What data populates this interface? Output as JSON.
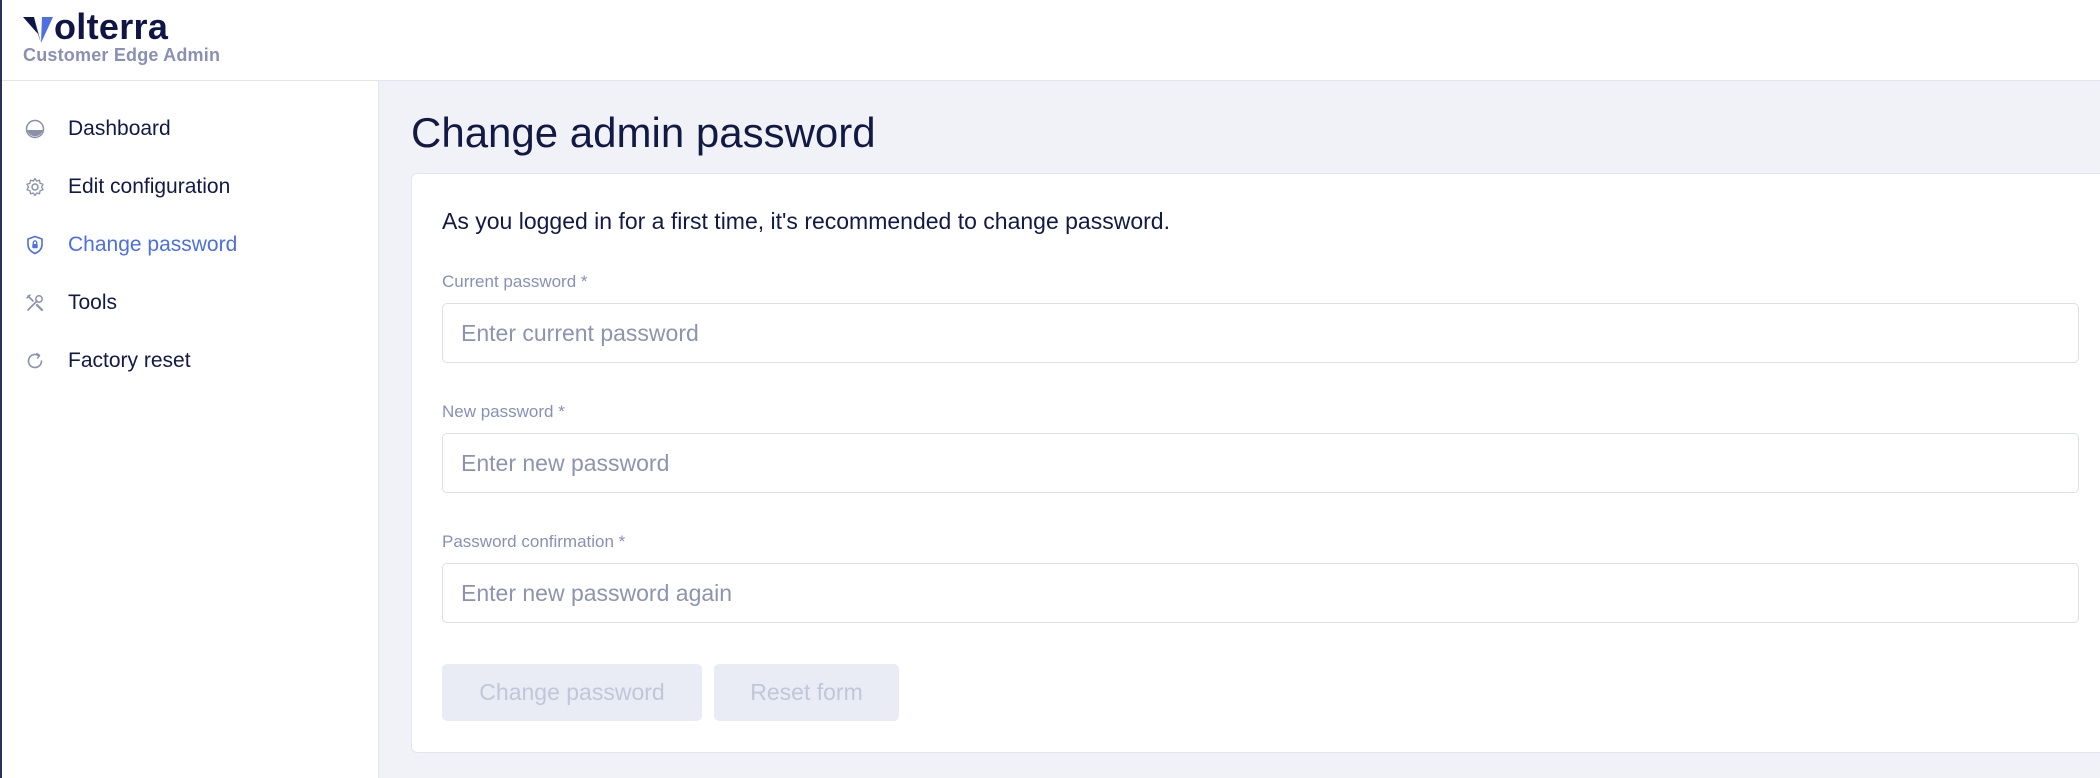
{
  "brand": {
    "name": "olterra",
    "subtitle": "Customer Edge Admin",
    "accent": "#4d6fe0",
    "dark": "#0f1645"
  },
  "sidebar": {
    "items": [
      {
        "label": "Dashboard",
        "icon": "dashboard-gauge-icon",
        "active": false
      },
      {
        "label": "Edit configuration",
        "icon": "gear-icon",
        "active": false
      },
      {
        "label": "Change password",
        "icon": "shield-lock-icon",
        "active": true
      },
      {
        "label": "Tools",
        "icon": "tools-icon",
        "active": false
      },
      {
        "label": "Factory reset",
        "icon": "refresh-icon",
        "active": false
      }
    ]
  },
  "main": {
    "title": "Change admin password",
    "intro": "As you logged in for a first time, it's recommended to change password.",
    "fields": {
      "current": {
        "label": "Current password *",
        "placeholder": "Enter current password",
        "value": ""
      },
      "new": {
        "label": "New password *",
        "placeholder": "Enter new password",
        "value": ""
      },
      "confirm": {
        "label": "Password confirmation *",
        "placeholder": "Enter new password again",
        "value": ""
      }
    },
    "buttons": {
      "submit_label": "Change password",
      "reset_label": "Reset form"
    }
  }
}
